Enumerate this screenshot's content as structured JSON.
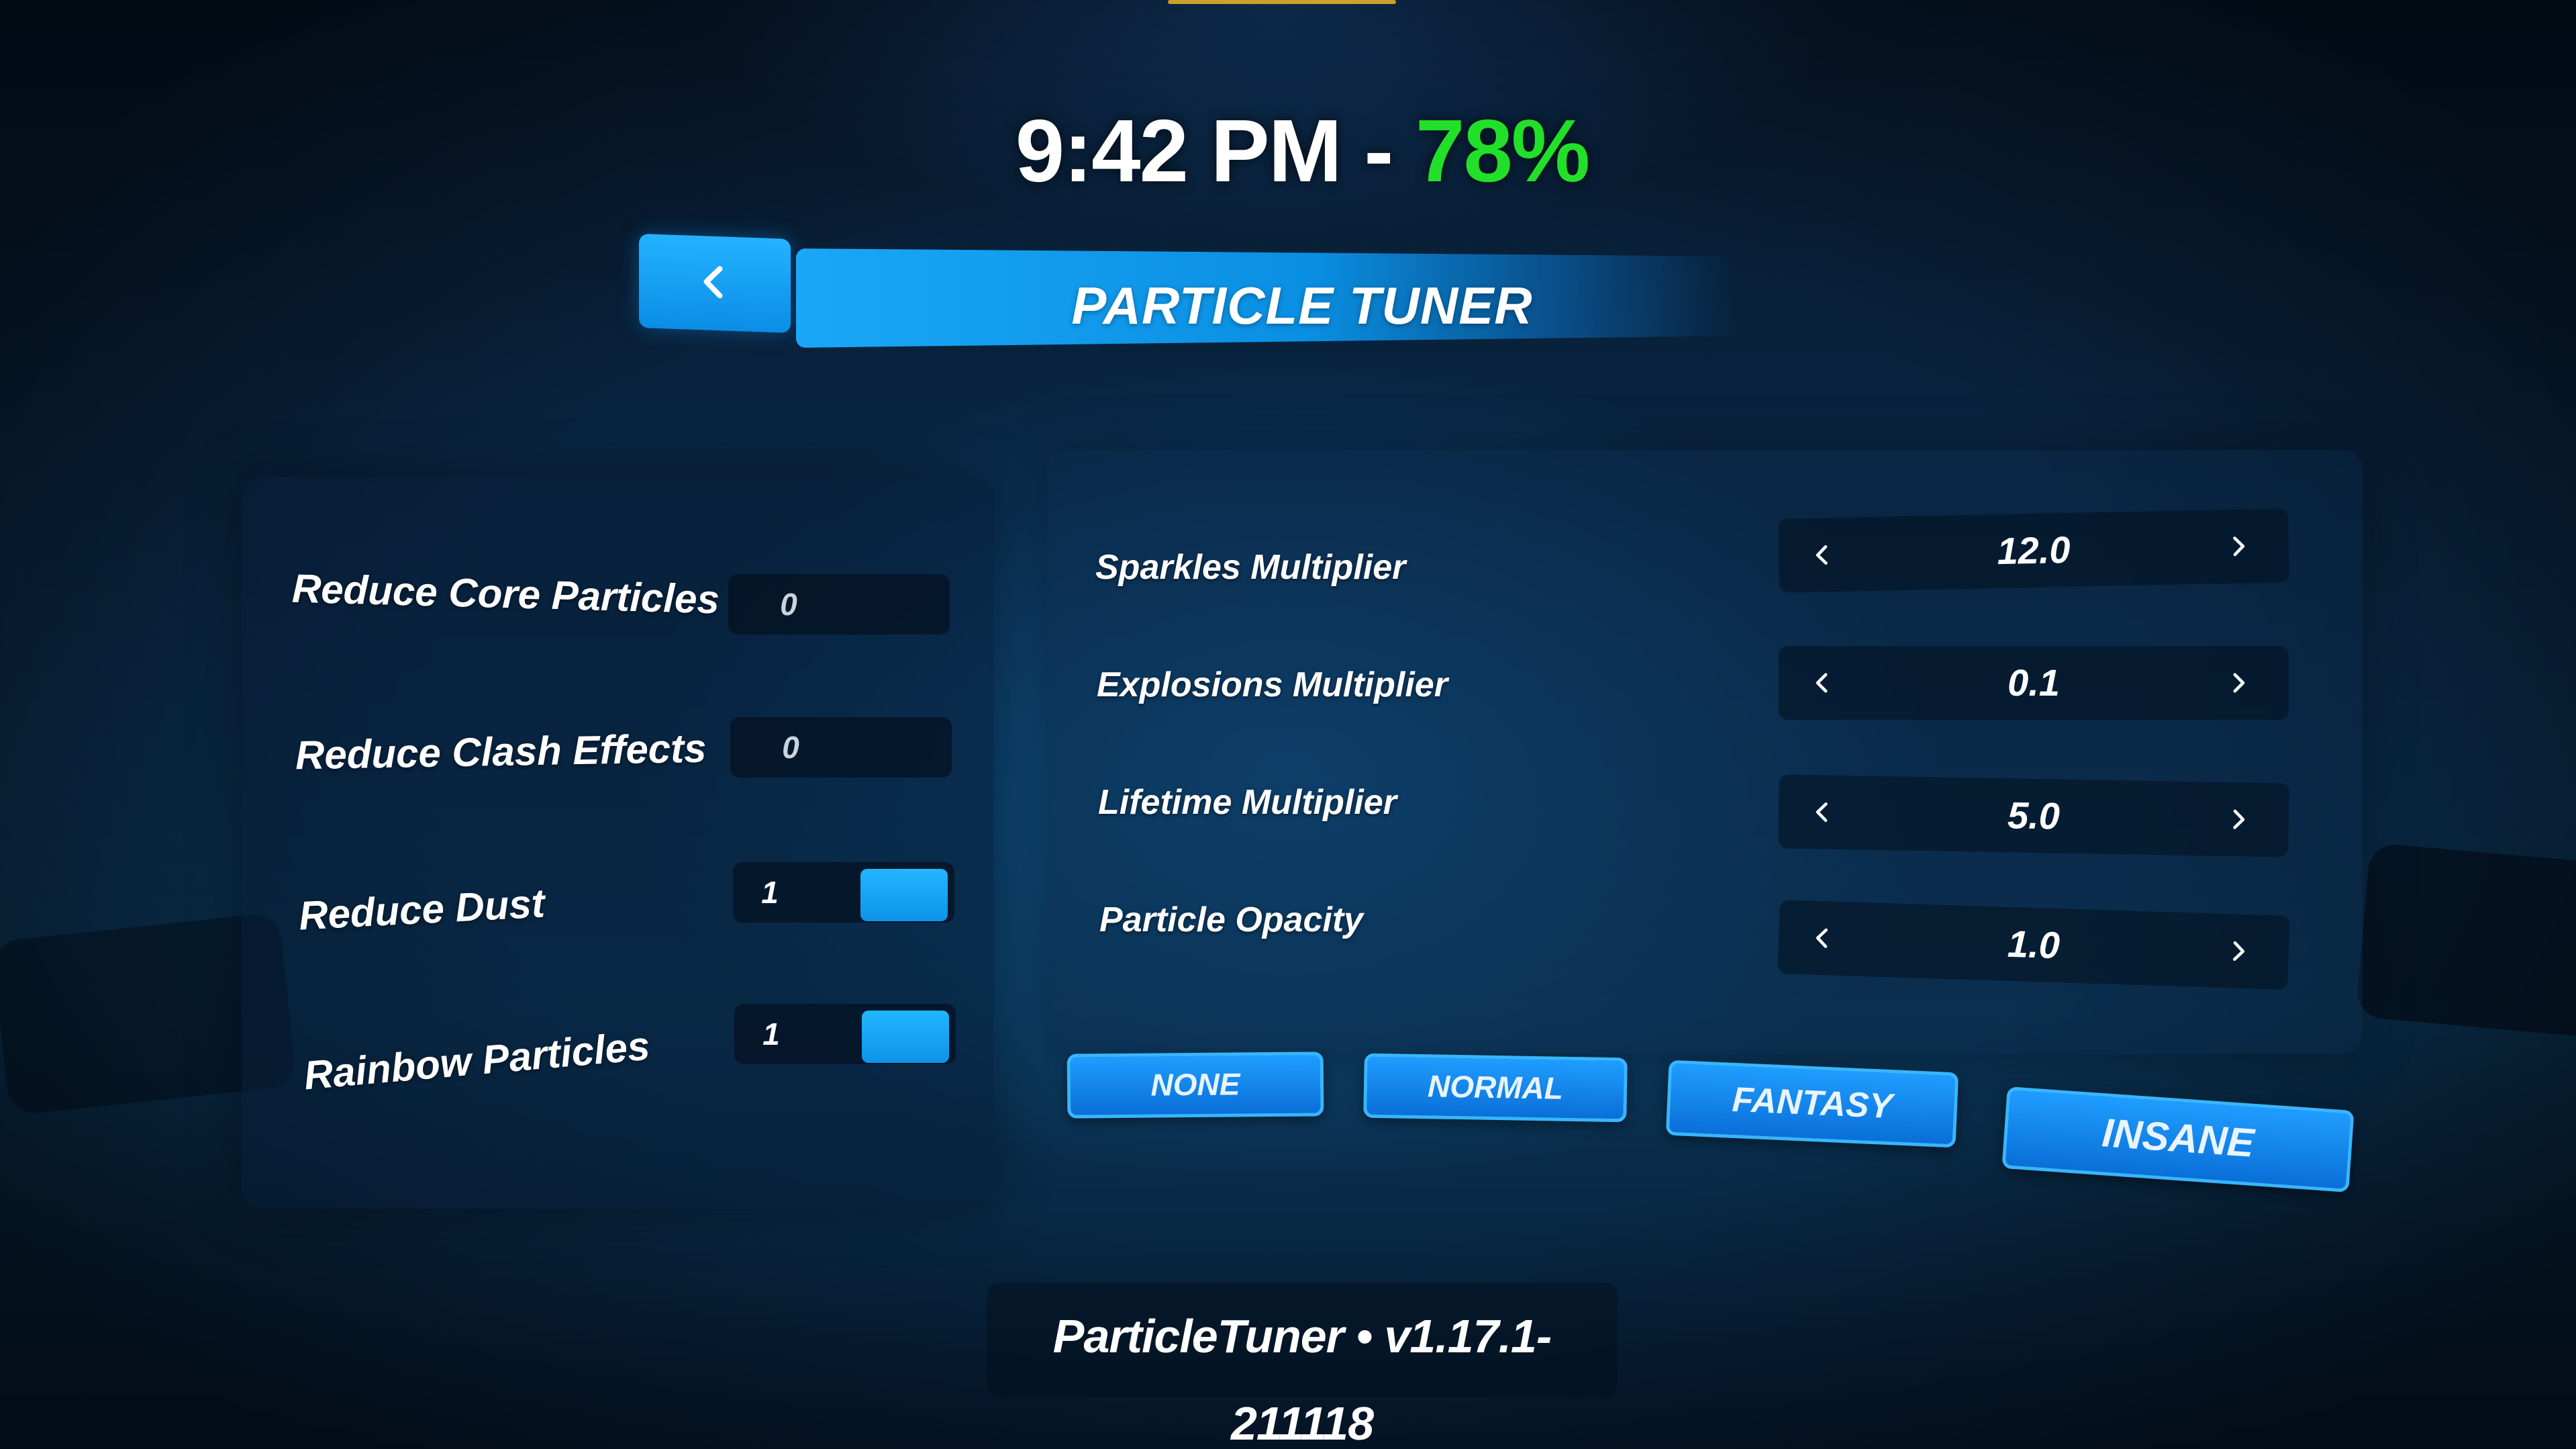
{
  "status": {
    "time": "9:42 PM",
    "separator": " - ",
    "battery": "78%",
    "battery_color": "#22e02a"
  },
  "header": {
    "back_icon": "chevron-left-icon",
    "title": "PARTICLE TUNER"
  },
  "toggles": [
    {
      "label": "Reduce Core Particles",
      "value": "0",
      "on": false
    },
    {
      "label": "Reduce Clash Effects",
      "value": "0",
      "on": false
    },
    {
      "label": "Reduce Dust",
      "value": "1",
      "on": true
    },
    {
      "label": "Rainbow Particles",
      "value": "1",
      "on": true
    }
  ],
  "sliders": [
    {
      "label": "Sparkles Multiplier",
      "value": "12.0"
    },
    {
      "label": "Explosions Multiplier",
      "value": "0.1"
    },
    {
      "label": "Lifetime Multiplier",
      "value": "5.0"
    },
    {
      "label": "Particle Opacity",
      "value": "1.0"
    }
  ],
  "presets": [
    "NONE",
    "NORMAL",
    "FANTASY",
    "INSANE"
  ],
  "footer": {
    "version": "ParticleTuner • v1.17.1-211118"
  },
  "colors": {
    "accent": "#1aa7f7",
    "background": "#07192e"
  }
}
